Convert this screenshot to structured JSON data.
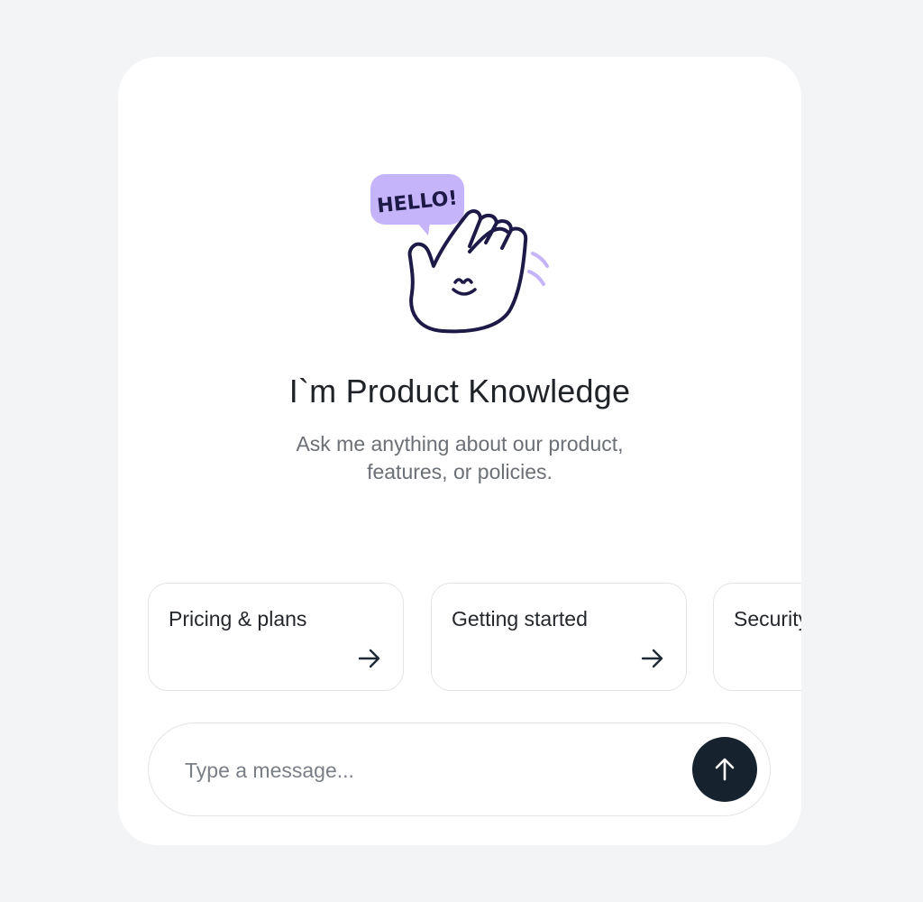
{
  "illustration": {
    "bubble_text": "HELLO!",
    "accent_color": "#c6b4fb",
    "line_color": "#1e1a48"
  },
  "header": {
    "title": "I`m Product Knowledge",
    "subtitle_line1": "Ask me anything about our product,",
    "subtitle_line2": "features, or policies."
  },
  "suggestions": [
    {
      "label": "Pricing & plans",
      "icon": "arrow-right-icon"
    },
    {
      "label": "Getting started",
      "icon": "arrow-right-icon"
    },
    {
      "label": "Security",
      "icon": "arrow-right-icon"
    }
  ],
  "composer": {
    "placeholder": "Type a message...",
    "send_icon": "arrow-up-icon",
    "send_color": "#16232f"
  }
}
